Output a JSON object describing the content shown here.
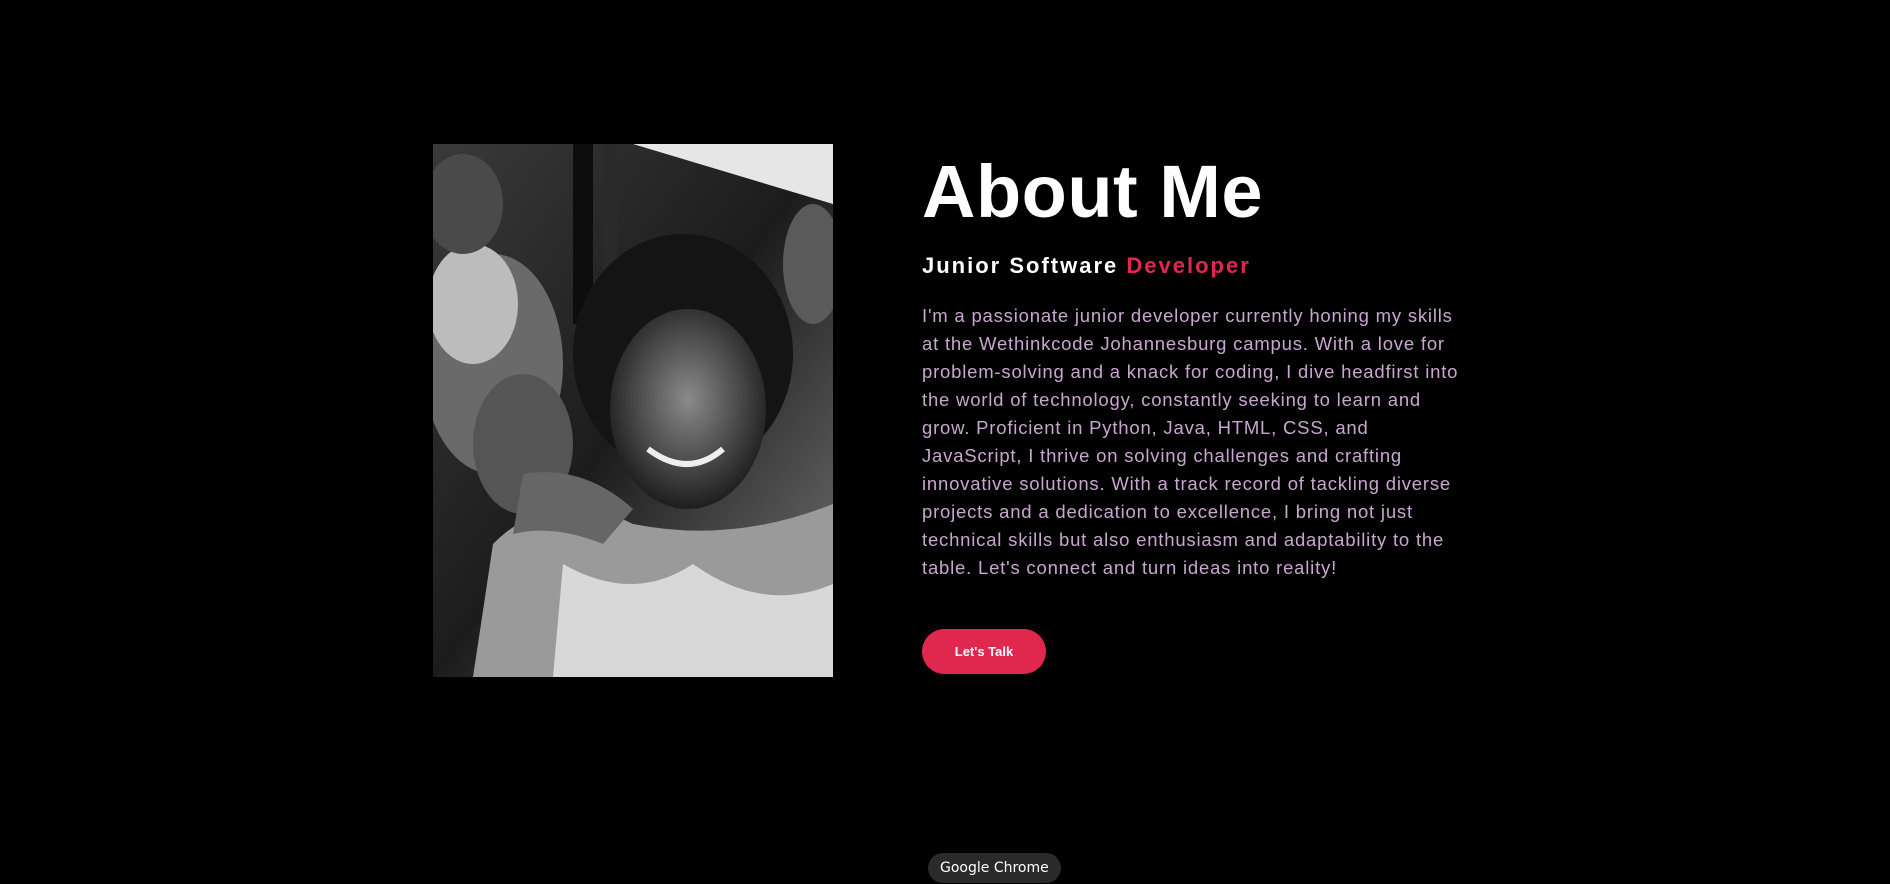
{
  "about": {
    "heading": "About Me",
    "role_prefix": "Junior Software",
    "role_accent": "Developer",
    "bio": "I'm a passionate junior developer currently honing my skills at the Wethinkcode Johannesburg campus. With a love for problem-solving and a knack for coding, I dive headfirst into the world of technology, constantly seeking to learn and grow. Proficient in Python, Java, HTML, CSS, and JavaScript, I thrive on solving challenges and crafting innovative solutions. With a track record of tackling diverse projects and a dedication to excellence, I bring not just technical skills but also enthusiasm and adaptability to the table. Let's connect and turn ideas into reality!",
    "cta_label": "Let's Talk"
  },
  "tooltip": {
    "label": "Google Chrome"
  },
  "colors": {
    "background": "#000000",
    "accent": "#e0284f",
    "bio_text": "#c9a6cf",
    "heading": "#ffffff"
  }
}
